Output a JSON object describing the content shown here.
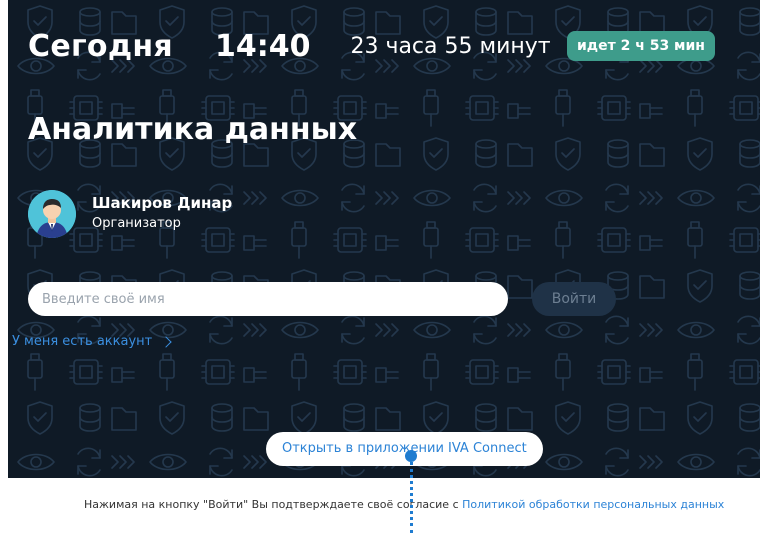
{
  "header": {
    "today_label": "Сегодня",
    "time": "14:40",
    "remaining": "23 часа 55 минут",
    "status_badge": "идет 2 ч 53 мин"
  },
  "meeting": {
    "title": "Аналитика данных"
  },
  "organizer": {
    "name": "Шакиров Динар",
    "role": "Организатор"
  },
  "login": {
    "name_placeholder": "Введите своё имя",
    "login_button": "Войти",
    "have_account_link": "У меня есть аккаунт"
  },
  "open_app_button": "Открыть в приложении IVA Connect",
  "consent": {
    "text": "Нажимая на кнопку \"Войти\" Вы подтверждаете своё согласие с ",
    "link": "Политикой обработки персональных данных"
  },
  "colors": {
    "hero_background": "#0f1a26",
    "badge_background": "#3e9c8b",
    "link_blue": "#2c83d6",
    "login_button_background": "#1f3247"
  },
  "icons": {
    "avatar": "person-avatar-icon",
    "chevron": "chevron-right-icon",
    "pattern": "security-pattern-icons"
  }
}
